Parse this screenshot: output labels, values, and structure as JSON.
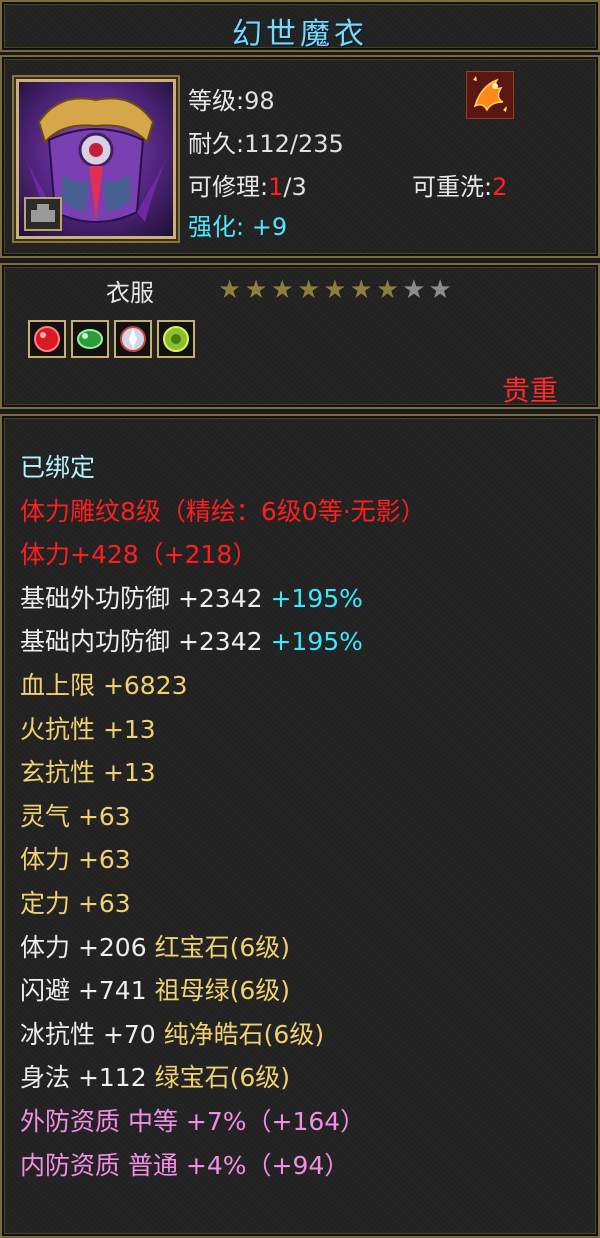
{
  "title": "幻世魔衣",
  "header": {
    "level_label": "等级:",
    "level_value": "98",
    "durability_label": "耐久:",
    "durability_value": "112/235",
    "repair_label": "可修理:",
    "repair_current": "1",
    "repair_max": "/3",
    "rewash_label": "可重洗:",
    "rewash_value": "2",
    "enhance_label": "强化: ",
    "enhance_value": "+9",
    "badge_icon": "phoenix-badge-icon"
  },
  "mid": {
    "item_type": "衣服",
    "stars_filled": 7,
    "stars_total": 9,
    "gems": [
      {
        "icon": "ruby-gem-icon",
        "color": "#d81a24"
      },
      {
        "icon": "emerald-gem-icon",
        "color": "#2e9a3e"
      },
      {
        "icon": "pure-crystal-gem-icon",
        "color": "#cfd8e8"
      },
      {
        "icon": "green-gem-icon",
        "color": "#8cc030"
      }
    ],
    "rarity": "贵重"
  },
  "attributes": [
    {
      "parts": [
        {
          "text": "已绑定",
          "color": "cyan"
        }
      ]
    },
    {
      "parts": [
        {
          "text": "体力雕纹8级（精绘：6级0等·无影）",
          "color": "red"
        }
      ]
    },
    {
      "parts": [
        {
          "text": "体力+428（+218）",
          "color": "red"
        }
      ]
    },
    {
      "parts": [
        {
          "text": "基础外功防御 +2342 ",
          "color": "white"
        },
        {
          "text": "+195%",
          "color": "aqua"
        }
      ]
    },
    {
      "parts": [
        {
          "text": "基础内功防御 +2342 ",
          "color": "white"
        },
        {
          "text": "+195%",
          "color": "aqua"
        }
      ]
    },
    {
      "parts": [
        {
          "text": "血上限 +6823",
          "color": "yellow"
        }
      ]
    },
    {
      "parts": [
        {
          "text": "火抗性 +13",
          "color": "yellow"
        }
      ]
    },
    {
      "parts": [
        {
          "text": "玄抗性 +13",
          "color": "yellow"
        }
      ]
    },
    {
      "parts": [
        {
          "text": "灵气 +63",
          "color": "yellow"
        }
      ]
    },
    {
      "parts": [
        {
          "text": "体力 +63",
          "color": "yellow"
        }
      ]
    },
    {
      "parts": [
        {
          "text": "定力 +63",
          "color": "yellow"
        }
      ]
    },
    {
      "parts": [
        {
          "text": "体力 +206 ",
          "color": "white"
        },
        {
          "text": "红宝石(6级)",
          "color": "gem"
        }
      ]
    },
    {
      "parts": [
        {
          "text": "闪避 +741 ",
          "color": "white"
        },
        {
          "text": "祖母绿(6级)",
          "color": "gem"
        }
      ]
    },
    {
      "parts": [
        {
          "text": "冰抗性 +70 ",
          "color": "white"
        },
        {
          "text": "纯净皓石(6级)",
          "color": "gem"
        }
      ]
    },
    {
      "parts": [
        {
          "text": "身法 +112 ",
          "color": "white"
        },
        {
          "text": "绿宝石(6级)",
          "color": "gem"
        }
      ]
    },
    {
      "parts": [
        {
          "text": "外防资质  中等 +7%（+164）",
          "color": "pink"
        }
      ]
    },
    {
      "parts": [
        {
          "text": "内防资质  普通 +4%（+94）",
          "color": "pink"
        }
      ]
    }
  ]
}
